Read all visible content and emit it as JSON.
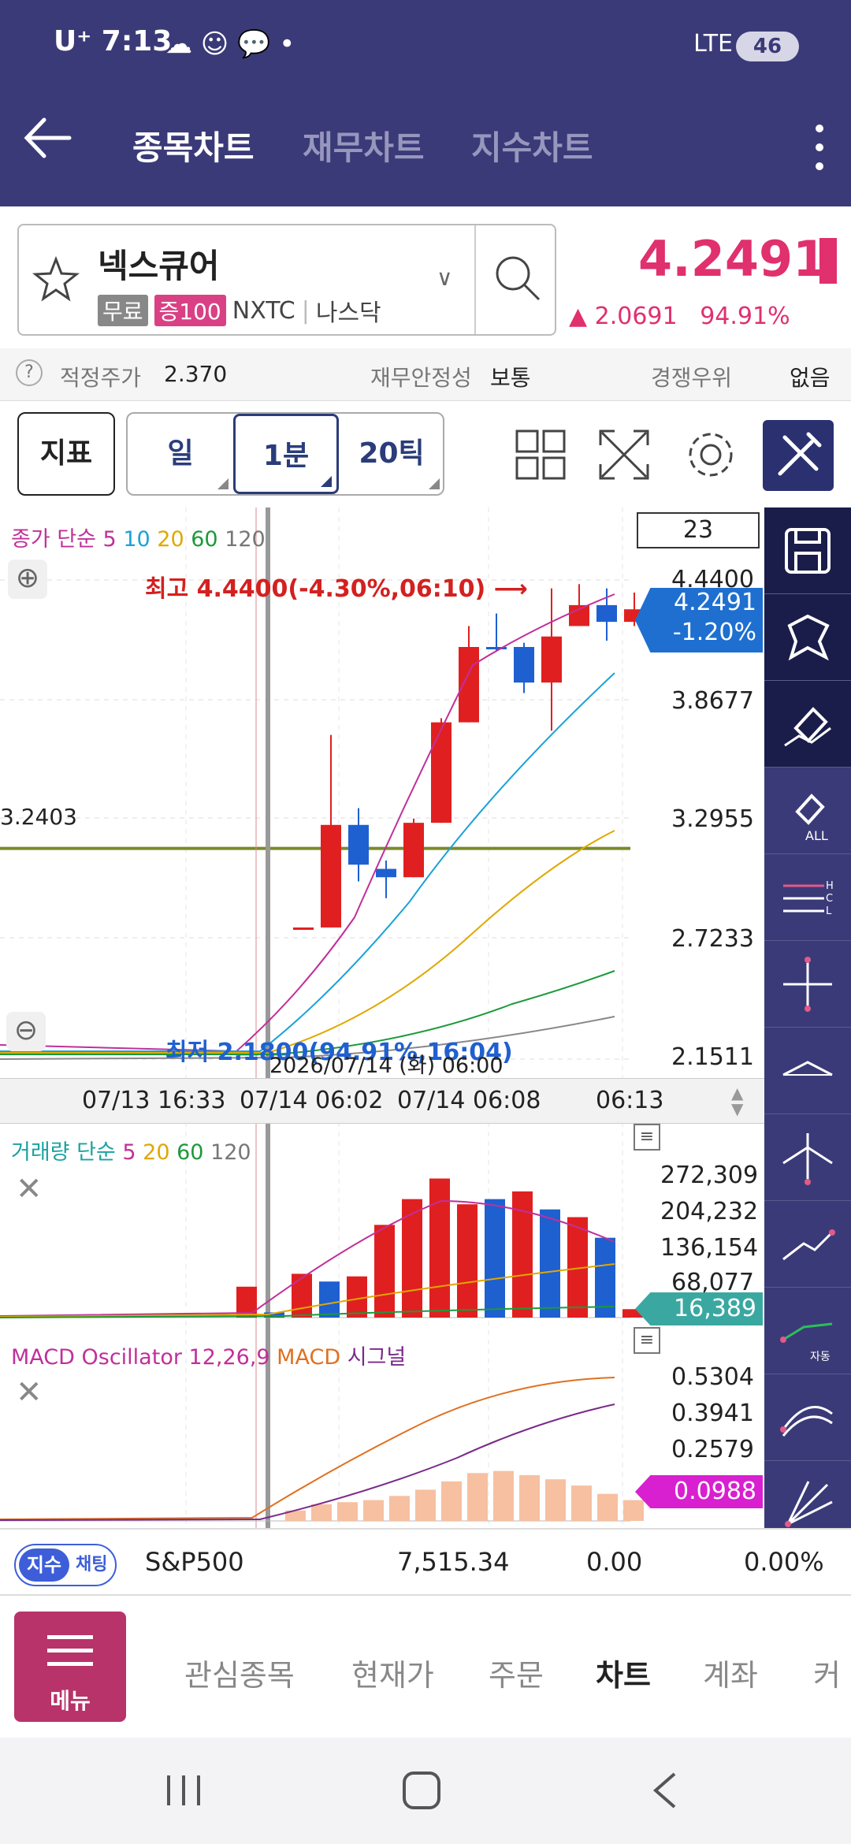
{
  "status": {
    "carrier": "U⁺ 7:13",
    "network": "LTE",
    "battery": "46"
  },
  "header": {
    "tabs": [
      {
        "label": "종목차트"
      },
      {
        "label": "재무차트"
      },
      {
        "label": "지수차트"
      }
    ]
  },
  "stock": {
    "name": "넥스큐어",
    "tags": [
      "무료",
      "증100"
    ],
    "code": "NXTC",
    "market": "나스닥",
    "price": "4.2491",
    "change": "▲ 2.0691",
    "change_pct": "94.91%"
  },
  "info": {
    "fair_label": "적정주가",
    "fair_value": "2.370",
    "stability_label": "재무안정성",
    "stability_value": "보통",
    "competitive_label": "경쟁우위",
    "competitive_value": "없음"
  },
  "toolbar": {
    "indicator": "지표",
    "periods": [
      "일",
      "1분",
      "20틱"
    ],
    "selected_period": "1분"
  },
  "chart": {
    "price_legend": {
      "title": "종가 단순",
      "p5": "5",
      "p10": "10",
      "p20": "20",
      "p60": "60",
      "p120": "120"
    },
    "count_box": "23",
    "high_label": "최고 4.4400(-4.30%,06:10) ⟶",
    "low_label": "최저 2.1800(94.91%,16:04)",
    "crosshair_date": "2026/07/14 (화) 06:00",
    "left_price": "3.2403",
    "current_price": "4.2491",
    "current_pct": "-1.20%",
    "y_ticks": [
      "4.4400",
      "3.8677",
      "3.2955",
      "2.7233",
      "2.1511"
    ],
    "x_ticks": [
      "07/13 16:33",
      "07/14 06:02",
      "07/14 06:08",
      "06:13"
    ],
    "volume_legend": {
      "title": "거래량 단순",
      "p5": "5",
      "p20": "20",
      "p60": "60",
      "p120": "120"
    },
    "volume_ticks": [
      "272,309",
      "204,232",
      "136,154",
      "68,077"
    ],
    "volume_current": "16,389",
    "macd_legend": {
      "title": "MACD Oscillator 12,26,9",
      "macd": "MACD",
      "signal": "시그널"
    },
    "macd_ticks": [
      "0.5304",
      "0.3941",
      "0.2579"
    ],
    "macd_current": "0.0988"
  },
  "chart_data": {
    "type": "candlestick",
    "ylim": [
      2.1511,
      4.44
    ],
    "candles": [
      {
        "o": 2.18,
        "h": 2.18,
        "l": 2.18,
        "c": 2.18,
        "dir": "down"
      },
      {
        "o": 2.18,
        "h": 2.18,
        "l": 2.18,
        "c": 2.18,
        "dir": "down"
      },
      {
        "o": 2.78,
        "h": 2.78,
        "l": 2.78,
        "c": 2.78,
        "dir": "up"
      },
      {
        "o": 2.78,
        "h": 3.7,
        "l": 2.78,
        "c": 3.27,
        "dir": "up"
      },
      {
        "o": 3.27,
        "h": 3.35,
        "l": 3.0,
        "c": 3.08,
        "dir": "down"
      },
      {
        "o": 3.06,
        "h": 3.1,
        "l": 2.92,
        "c": 3.02,
        "dir": "down"
      },
      {
        "o": 3.02,
        "h": 3.3,
        "l": 3.02,
        "c": 3.28,
        "dir": "up"
      },
      {
        "o": 3.28,
        "h": 3.78,
        "l": 3.28,
        "c": 3.76,
        "dir": "up"
      },
      {
        "o": 3.76,
        "h": 4.22,
        "l": 3.76,
        "c": 4.12,
        "dir": "up"
      },
      {
        "o": 4.12,
        "h": 4.28,
        "l": 4.1,
        "c": 4.12,
        "dir": "down"
      },
      {
        "o": 4.12,
        "h": 4.14,
        "l": 3.9,
        "c": 3.95,
        "dir": "down"
      },
      {
        "o": 3.95,
        "h": 4.4,
        "l": 3.72,
        "c": 4.17,
        "dir": "up"
      },
      {
        "o": 4.22,
        "h": 4.42,
        "l": 4.22,
        "c": 4.32,
        "dir": "up"
      },
      {
        "o": 4.32,
        "h": 4.4,
        "l": 4.15,
        "c": 4.24,
        "dir": "down"
      },
      {
        "o": 4.24,
        "h": 4.38,
        "l": 4.22,
        "c": 4.3,
        "dir": "up"
      },
      {
        "o": 4.3,
        "h": 4.31,
        "l": 4.25,
        "c": 4.27,
        "dir": "down"
      }
    ],
    "volume_max": 272309,
    "volumes": [
      0,
      0,
      0,
      0,
      0,
      0,
      0,
      0,
      60000,
      10000,
      85000,
      70000,
      80000,
      180000,
      230000,
      270000,
      220000,
      230000,
      245000,
      210000,
      195000,
      155000,
      16389
    ],
    "macd_hist": [
      0,
      0,
      0,
      0.05,
      0.08,
      0.09,
      0.1,
      0.12,
      0.15,
      0.19,
      0.23,
      0.24,
      0.22,
      0.2,
      0.17,
      0.13,
      0.1
    ]
  },
  "ticker": {
    "pill_a": "지수",
    "pill_b": "채팅",
    "name": "S&P500",
    "value": "7,515.34",
    "change": "0.00",
    "pct": "0.00%"
  },
  "nav": {
    "menu": "메뉴",
    "items": [
      "관심종목",
      "현재가",
      "주문",
      "차트",
      "계좌",
      "커"
    ],
    "active": "차트"
  }
}
